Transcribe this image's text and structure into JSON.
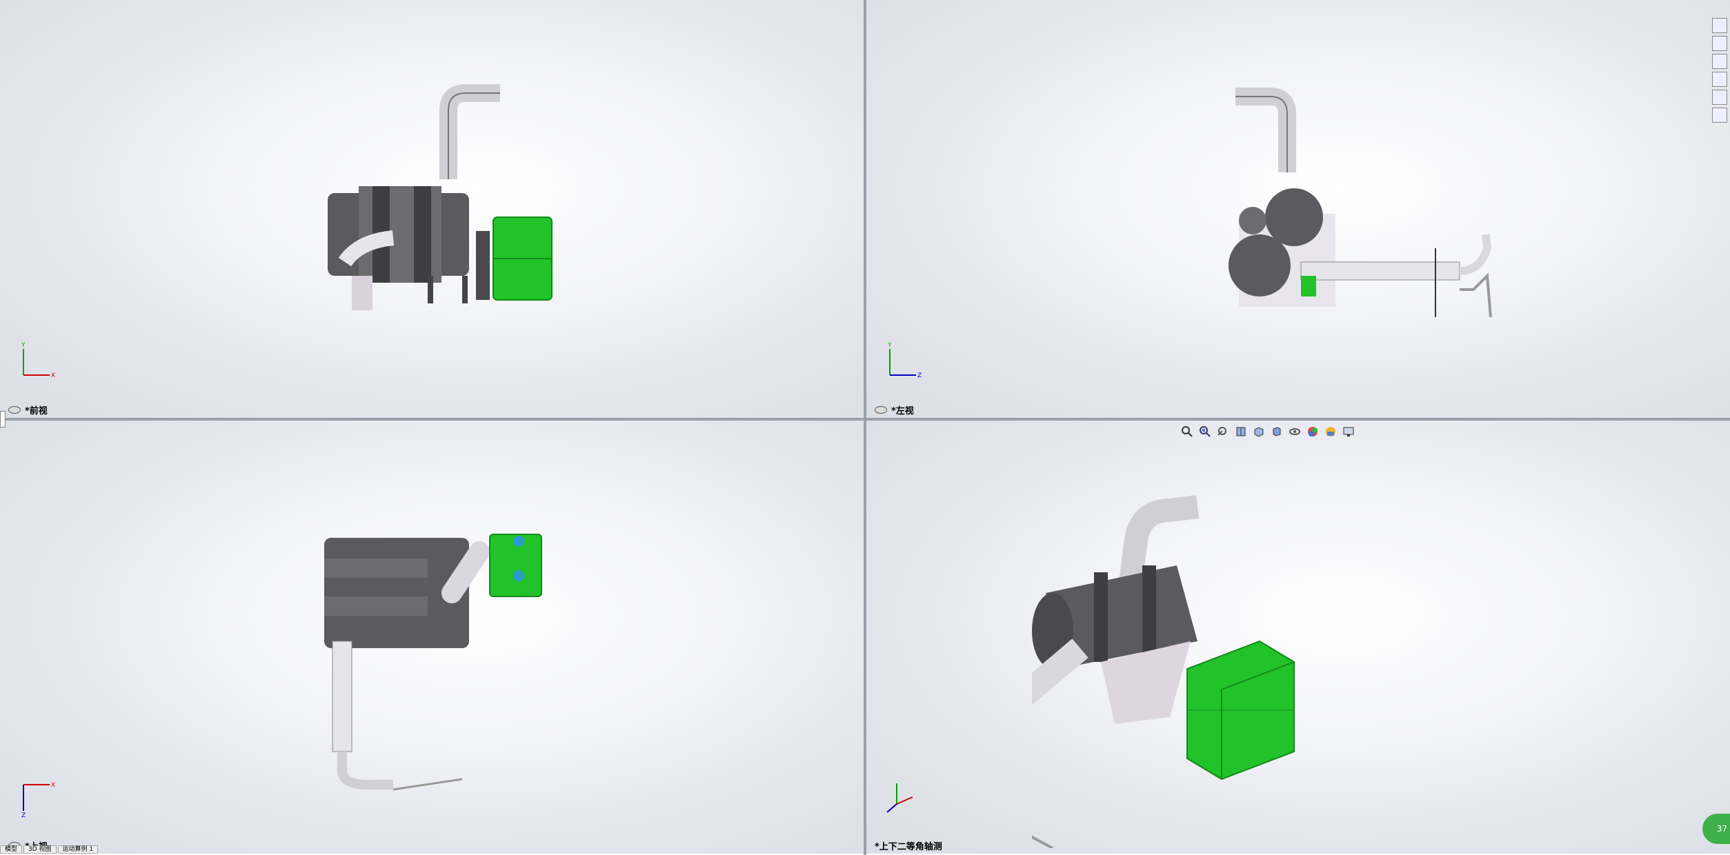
{
  "views": {
    "front": {
      "label": "*前视",
      "axis_h": "X",
      "axis_v": "Y"
    },
    "left": {
      "label": "*左视",
      "axis_h": "Z",
      "axis_v": "Y"
    },
    "top": {
      "label": "*上视",
      "axis_h": "X",
      "axis_v": "Z"
    },
    "iso": {
      "label": "*上下二等角轴测"
    }
  },
  "colors": {
    "axis_x": "#d00000",
    "axis_y": "#00a000",
    "axis_z": "#0000c0",
    "tank": "#22c22a",
    "metal": "#5a5a5f"
  },
  "hud_icons": [
    "zoom-to-fit-icon",
    "zoom-area-icon",
    "previous-view-icon",
    "section-view-icon",
    "view-orientation-icon",
    "display-style-icon",
    "hide-show-icon",
    "edit-appearance-icon",
    "apply-scene-icon",
    "view-settings-icon"
  ],
  "taskpane_icons": [
    "home-icon",
    "resources-icon",
    "design-library-icon",
    "file-explorer-icon",
    "appearances-icon",
    "custom-properties-icon"
  ],
  "badge": {
    "text": "37"
  },
  "bottom_tabs": [
    "模型",
    "3D 视图",
    "运动算例 1"
  ]
}
